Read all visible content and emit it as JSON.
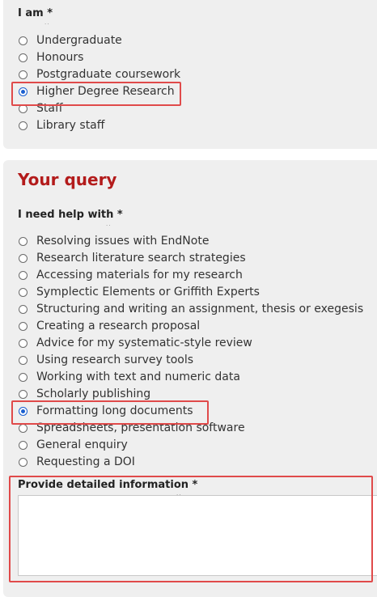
{
  "iam": {
    "label": "I am",
    "required_mark": "*",
    "options": [
      {
        "label": "Undergraduate",
        "checked": false
      },
      {
        "label": "Honours",
        "checked": false
      },
      {
        "label": "Postgraduate coursework",
        "checked": false
      },
      {
        "label": "Higher Degree Research",
        "checked": true
      },
      {
        "label": "Staff",
        "checked": false
      },
      {
        "label": "Library staff",
        "checked": false
      }
    ]
  },
  "query": {
    "heading": "Your query",
    "help_label": "I need help with",
    "required_mark": "*",
    "options": [
      {
        "label": "Resolving issues with EndNote",
        "checked": false
      },
      {
        "label": "Research literature search strategies",
        "checked": false
      },
      {
        "label": "Accessing materials for my research",
        "checked": false
      },
      {
        "label": "Symplectic Elements or Griffith Experts",
        "checked": false
      },
      {
        "label": "Structuring and writing an assignment, thesis or exegesis",
        "checked": false
      },
      {
        "label": "Creating a research proposal",
        "checked": false
      },
      {
        "label": "Advice for my systematic-style review",
        "checked": false
      },
      {
        "label": "Using research survey tools",
        "checked": false
      },
      {
        "label": "Working with text and numeric data",
        "checked": false
      },
      {
        "label": "Scholarly publishing",
        "checked": false
      },
      {
        "label": "Formatting long documents",
        "checked": true
      },
      {
        "label": "Spreadsheets, presentation software",
        "checked": false
      },
      {
        "label": "General enquiry",
        "checked": false
      },
      {
        "label": "Requesting a DOI",
        "checked": false
      }
    ],
    "detail_label": "Provide detailed information",
    "detail_value": ""
  },
  "colors": {
    "heading": "#b31b1b",
    "highlight": "#e04a4a",
    "radio_selected": "#1a5fd0"
  }
}
